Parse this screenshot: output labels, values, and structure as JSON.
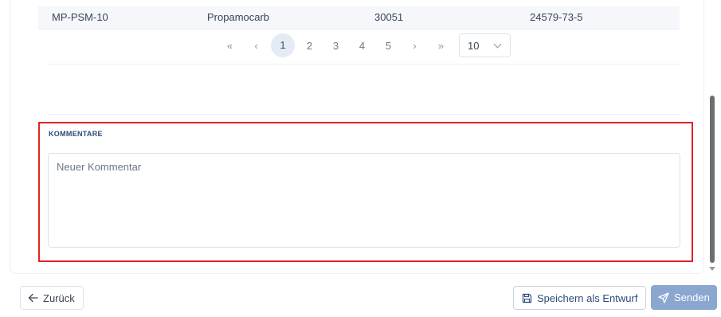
{
  "table": {
    "last_row": {
      "code": "MP-PSM-10",
      "name": "Propamocarb",
      "number": "30051",
      "cas": "24579-73-5"
    }
  },
  "pagination": {
    "first": "«",
    "prev": "‹",
    "pages": [
      "1",
      "2",
      "3",
      "4",
      "5"
    ],
    "current": "1",
    "next": "›",
    "last": "»",
    "page_size": "10"
  },
  "comments": {
    "heading": "KOMMENTARE",
    "placeholder": "Neuer Kommentar",
    "value": ""
  },
  "footer": {
    "back_label": "Zurück",
    "draft_label": "Speichern als Entwurf",
    "send_label": "Senden"
  },
  "colors": {
    "accent": "#8aa7cf",
    "heading": "#2d4a7a",
    "highlight": "#e02424",
    "active_page_bg": "#e4ebf5"
  },
  "icons": {
    "back": "arrow-left-icon",
    "draft": "floppy-disk-icon",
    "send": "paper-plane-icon",
    "dropdown": "chevron-down-icon"
  }
}
